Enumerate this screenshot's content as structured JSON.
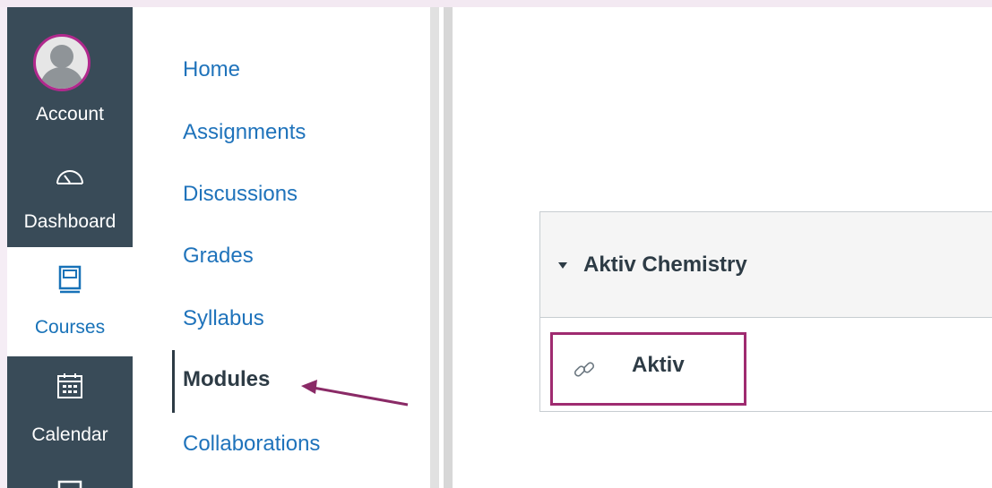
{
  "global_nav": {
    "account": "Account",
    "dashboard": "Dashboard",
    "courses": "Courses",
    "calendar": "Calendar"
  },
  "course_nav": {
    "items": [
      {
        "label": "Home"
      },
      {
        "label": "Assignments"
      },
      {
        "label": "Discussions"
      },
      {
        "label": "Grades"
      },
      {
        "label": "Syllabus"
      },
      {
        "label": "Modules"
      },
      {
        "label": "Collaborations"
      }
    ]
  },
  "module": {
    "title": "Aktiv Chemistry",
    "item": "Aktiv"
  },
  "colors": {
    "accent": "#1f73bb",
    "highlight": "#9f2b70",
    "nav_bg": "#394b58"
  }
}
